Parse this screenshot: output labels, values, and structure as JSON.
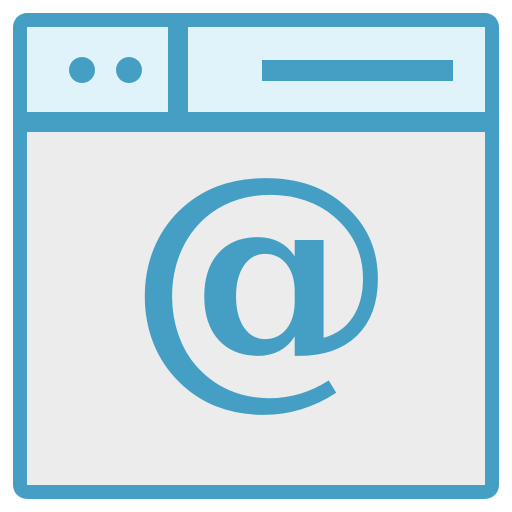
{
  "icon": {
    "name": "browser-email-icon",
    "symbol": "@",
    "colors": {
      "stroke": "#459FC5",
      "titlebar_fill": "#E0F3FB",
      "content_fill": "#ECECEC",
      "background": "#FFFFFF"
    },
    "parts": [
      "window-dots",
      "address-bar-line",
      "at-sign"
    ]
  }
}
